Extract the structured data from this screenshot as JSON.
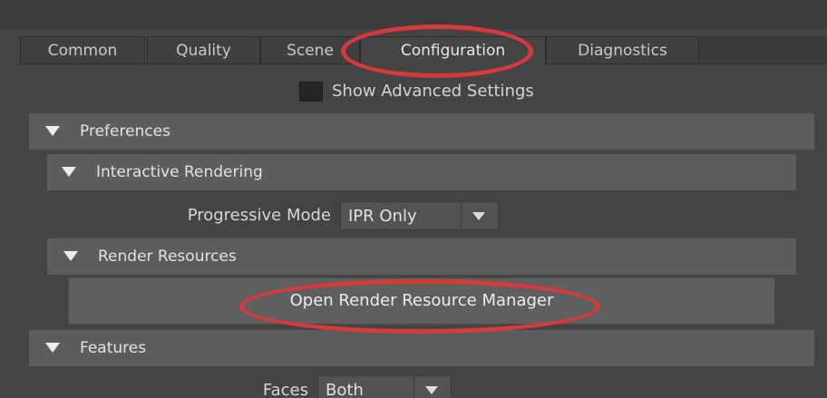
{
  "tabs": [
    {
      "label": "Common"
    },
    {
      "label": "Quality"
    },
    {
      "label": "Scene"
    },
    {
      "label": "Configuration"
    },
    {
      "label": "Diagnostics"
    }
  ],
  "active_tab": "Configuration",
  "show_advanced": {
    "label": "Show Advanced Settings",
    "checked": false
  },
  "sections": {
    "preferences": {
      "label": "Preferences"
    },
    "interactive_rendering": {
      "label": "Interactive Rendering"
    },
    "render_resources": {
      "label": "Render Resources"
    },
    "features": {
      "label": "Features"
    }
  },
  "progressive_mode": {
    "label": "Progressive Mode",
    "value": "IPR Only"
  },
  "render_resource_button": {
    "label": "Open Render Resource Manager"
  },
  "faces": {
    "label": "Faces",
    "value": "Both"
  },
  "annotation_color": "#d63a3a"
}
